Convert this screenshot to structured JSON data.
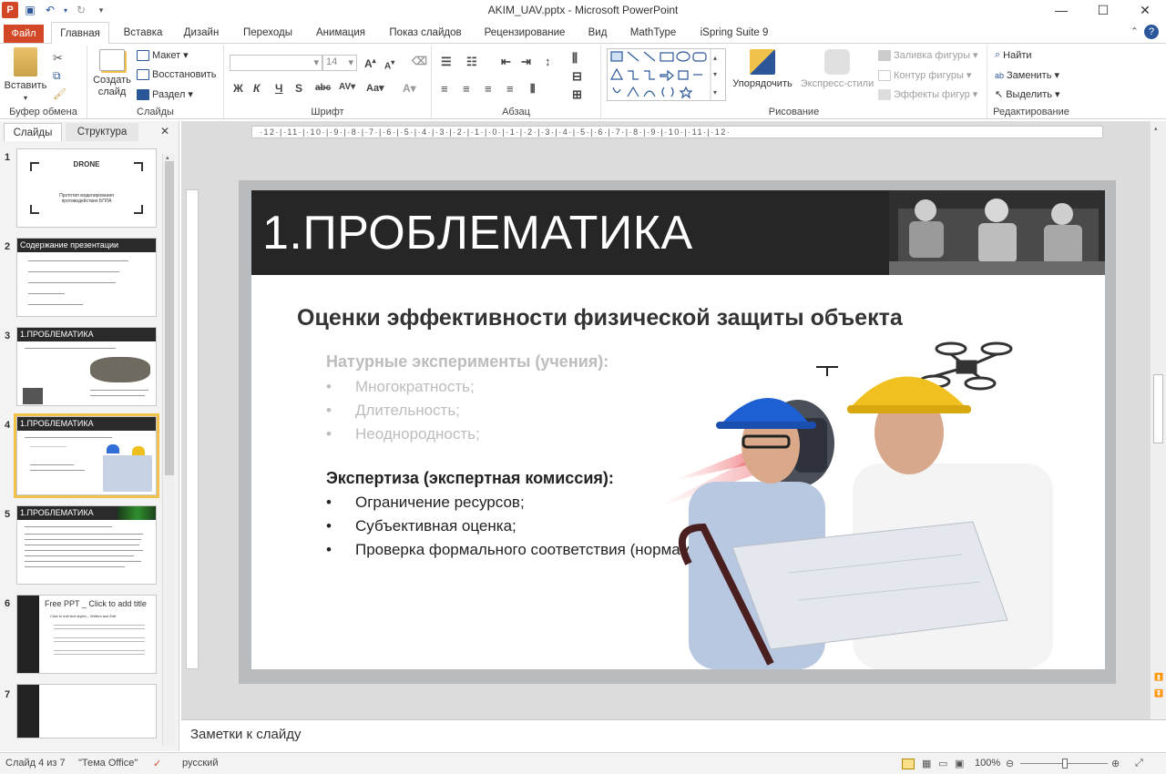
{
  "window": {
    "title": "AKIM_UAV.pptx  -  Microsoft PowerPoint",
    "controls": [
      "—",
      "☐",
      "✕"
    ]
  },
  "tabs": [
    "Файл",
    "Главная",
    "Вставка",
    "Дизайн",
    "Переходы",
    "Анимация",
    "Показ слайдов",
    "Рецензирование",
    "Вид",
    "MathType",
    "iSpring Suite 9"
  ],
  "ribbon": {
    "clipboard": {
      "label": "Буфер обмена",
      "paste": "Вставить"
    },
    "slides": {
      "label": "Слайды",
      "new_slide": "Создать слайд",
      "layout": "Макет",
      "reset": "Восстановить",
      "section": "Раздел"
    },
    "font": {
      "label": "Шрифт",
      "size": "14"
    },
    "paragraph": {
      "label": "Абзац"
    },
    "drawing": {
      "label": "Рисование",
      "arrange": "Упорядочить",
      "quick_styles": "Экспресс-стили",
      "fill": "Заливка фигуры",
      "outline": "Контур фигуры",
      "effects": "Эффекты фигур"
    },
    "editing": {
      "label": "Редактирование",
      "find": "Найти",
      "replace": "Заменить",
      "select": "Выделить"
    }
  },
  "panel": {
    "tabs": [
      "Слайды",
      "Структура"
    ],
    "close": "✕",
    "thumbs": [
      {
        "num": "1",
        "title": "DRONE",
        "sub": "Прототип моделирования противодействия БПЛА"
      },
      {
        "num": "2",
        "title": "Содержание презентации"
      },
      {
        "num": "3",
        "title": "1.ПРОБЛЕМАТИКА"
      },
      {
        "num": "4",
        "title": "1.ПРОБЛЕМАТИКА"
      },
      {
        "num": "5",
        "title": "1.ПРОБЛЕМАТИКА"
      },
      {
        "num": "6",
        "title": "Free PPT _ Click to add title",
        "sub": "Click to edit text styles – Writers and Edit"
      },
      {
        "num": "7",
        "title": ""
      }
    ]
  },
  "ruler": "·12·|·11·|·10·|·9·|·8·|·7·|·6·|·5·|·4·|·3·|·2·|·1·|·0·|·1·|·2·|·3·|·4·|·5·|·6·|·7·|·8·|·9·|·10·|·11·|·12·",
  "slide": {
    "title": "1.ПРОБЛЕМАТИКА",
    "subtitle": "Оценки эффективности физической защиты объекта",
    "section1": "Натурные эксперименты (учения):",
    "bullets1": [
      "Многократность;",
      "Длительность;",
      "Неоднородность;"
    ],
    "section2": "Экспертиза (экспертная комиссия):",
    "bullets2": [
      "Ограничение ресурсов;",
      "Субъективная оценка;",
      "Проверка формального соответствия (нормам);"
    ],
    "bullet_char": "•"
  },
  "notes": "Заметки к слайду",
  "status": {
    "slide": "Слайд 4 из 7",
    "theme": "\"Тема Office\"",
    "lang": "русский",
    "zoom": "100%"
  },
  "colors": {
    "file_tab": "#d24726",
    "accent": "#2b579a",
    "slide_header": "#262626"
  }
}
